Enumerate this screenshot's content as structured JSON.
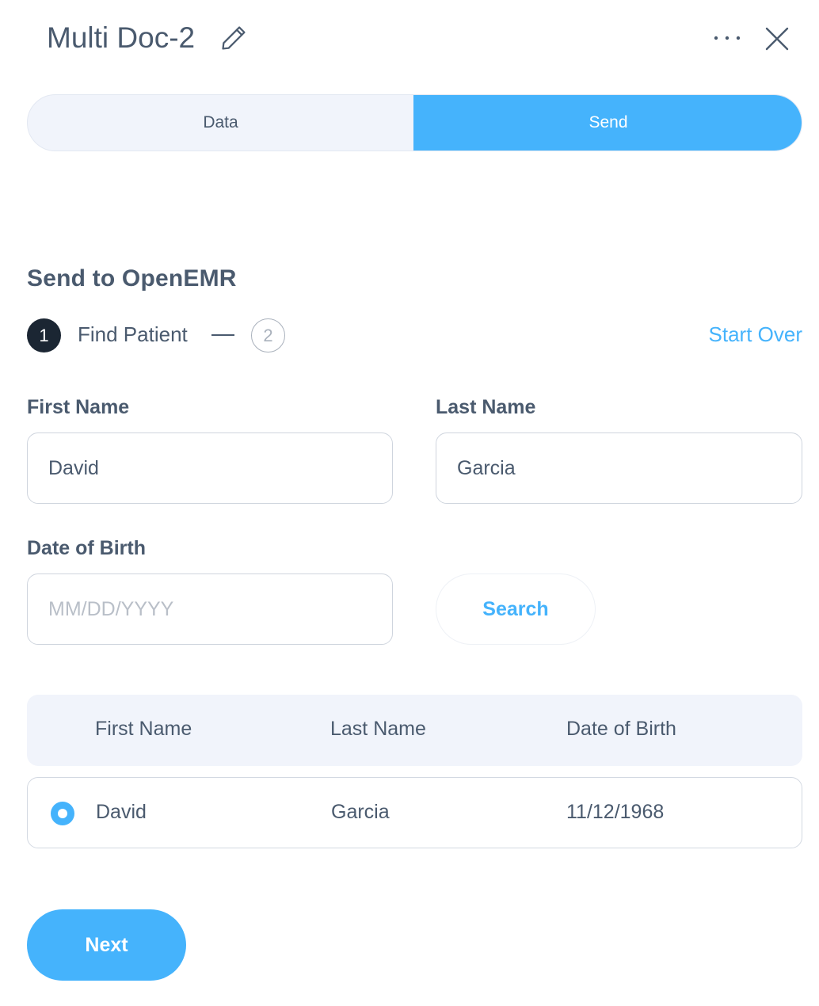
{
  "header": {
    "title": "Multi Doc-2",
    "edit_icon": "pencil-icon",
    "more_icon": "more-horizontal-icon",
    "close_icon": "close-icon"
  },
  "tabs": [
    {
      "label": "Data",
      "active": false
    },
    {
      "label": "Send",
      "active": true
    }
  ],
  "section": {
    "title": "Send to OpenEMR",
    "steps": [
      {
        "number": "1",
        "label": "Find Patient",
        "active": true
      },
      {
        "number": "2",
        "label": "",
        "active": false
      }
    ],
    "start_over": "Start Over"
  },
  "form": {
    "first_name": {
      "label": "First Name",
      "value": "David"
    },
    "last_name": {
      "label": "Last Name",
      "value": "Garcia"
    },
    "dob": {
      "label": "Date of Birth",
      "value": "",
      "placeholder": "MM/DD/YYYY"
    },
    "search_label": "Search"
  },
  "results": {
    "columns": [
      "First Name",
      "Last Name",
      "Date of Birth"
    ],
    "rows": [
      {
        "first_name": "David",
        "last_name": "Garcia",
        "dob": "11/12/1968",
        "selected": true
      }
    ]
  },
  "next_label": "Next",
  "colors": {
    "accent": "#45b3fc",
    "text": "#4a5a6e",
    "step_active": "#1b2633",
    "panel_bg": "#f1f4fb"
  }
}
